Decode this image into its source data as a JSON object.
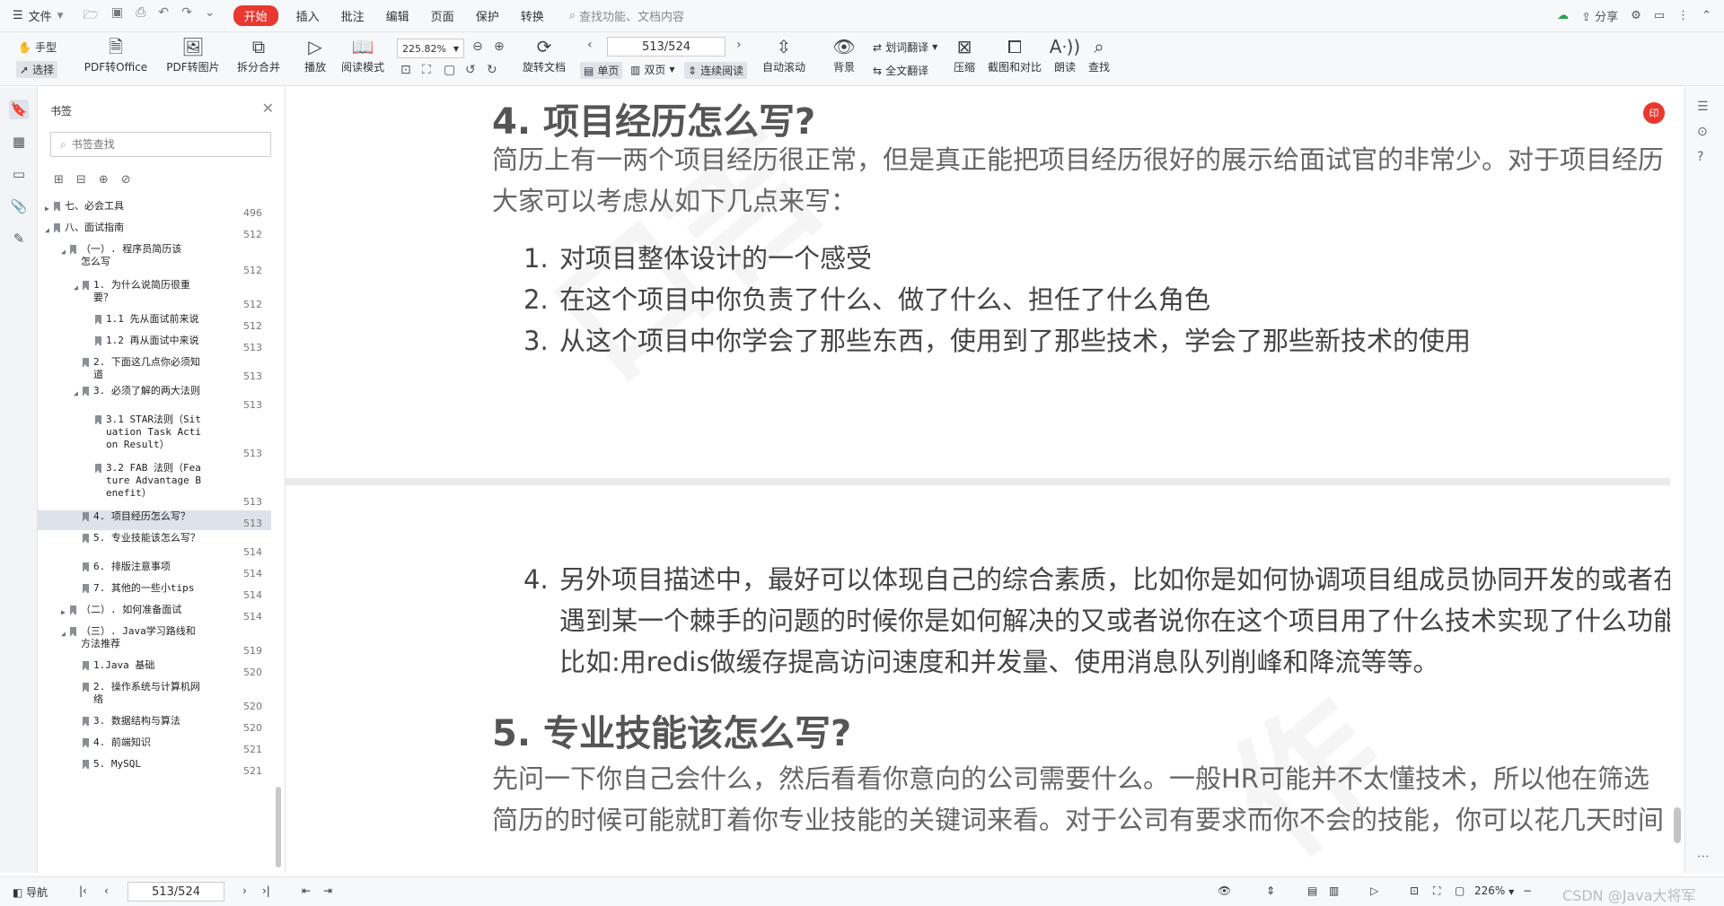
{
  "menubar": {
    "file": "文件",
    "tabs": [
      "开始",
      "插入",
      "批注",
      "编辑",
      "页面",
      "保护",
      "转换"
    ],
    "active_tab": "开始",
    "search_placeholder": "查找功能、文档内容",
    "share": "分享"
  },
  "toolbar": {
    "hand": "手型",
    "select": "选择",
    "pdf_to_office": "PDF转Office",
    "pdf_to_image": "PDF转图片",
    "split_merge": "拆分合并",
    "play": "播放",
    "read_mode": "阅读模式",
    "zoom": "225.82%",
    "rotate": "旋转文档",
    "page_indicator": "513/524",
    "single_page": "单页",
    "double_page": "双页",
    "continuous": "连续阅读",
    "auto_scroll": "自动滚动",
    "background": "背景",
    "word_translate": "划词翻译",
    "full_translate": "全文翻译",
    "compress": "压缩",
    "screenshot_compare": "截图和对比",
    "read_aloud": "朗读",
    "find": "查找"
  },
  "bookmark_panel": {
    "title": "书签",
    "search_placeholder": "书签查找",
    "items": [
      {
        "label": "七、必会工具",
        "page": "496",
        "level": 0,
        "toggle": "collapsed"
      },
      {
        "label": "八、面试指南",
        "page": "512",
        "level": 0,
        "toggle": "expanded"
      },
      {
        "label": "（一）. 程序员简历该怎么写",
        "page": "512",
        "level": 1,
        "toggle": "expanded"
      },
      {
        "label": "1. 为什么说简历很重要？",
        "page": "512",
        "level": 2,
        "toggle": "expanded"
      },
      {
        "label": "1.1 先从面试前来说",
        "page": "512",
        "level": 3,
        "toggle": "none"
      },
      {
        "label": "1.2 再从面试中来说",
        "page": "513",
        "level": 3,
        "toggle": "none"
      },
      {
        "label": "2. 下面这几点你必须知道",
        "page": "513",
        "level": 2,
        "toggle": "none"
      },
      {
        "label": "3. 必须了解的两大法则",
        "page": "513",
        "level": 2,
        "toggle": "expanded"
      },
      {
        "label": "3.1 STAR法则（Situation Task Action Result）",
        "page": "513",
        "level": 3,
        "toggle": "none"
      },
      {
        "label": "3.2 FAB 法则（Feature Advantage Benefit）",
        "page": "513",
        "level": 3,
        "toggle": "none"
      },
      {
        "label": "4. 项目经历怎么写？",
        "page": "513",
        "level": 2,
        "toggle": "none",
        "selected": true
      },
      {
        "label": "5. 专业技能该怎么写？",
        "page": "514",
        "level": 2,
        "toggle": "none"
      },
      {
        "label": "6. 排版注意事项",
        "page": "514",
        "level": 2,
        "toggle": "none"
      },
      {
        "label": "7. 其他的一些小tips",
        "page": "514",
        "level": 2,
        "toggle": "none"
      },
      {
        "label": "（二）. 如何准备面试",
        "page": "514",
        "level": 1,
        "toggle": "collapsed"
      },
      {
        "label": "（三）. Java学习路线和方法推荐",
        "page": "519",
        "level": 1,
        "toggle": "expanded"
      },
      {
        "label": "1.Java 基础",
        "page": "520",
        "level": 2,
        "toggle": "none"
      },
      {
        "label": "2. 操作系统与计算机网络",
        "page": "520",
        "level": 2,
        "toggle": "none"
      },
      {
        "label": "3. 数据结构与算法",
        "page": "520",
        "level": 2,
        "toggle": "none"
      },
      {
        "label": "4. 前端知识",
        "page": "521",
        "level": 2,
        "toggle": "none"
      },
      {
        "label": "5. MySQL",
        "page": "521",
        "level": 2,
        "toggle": "none"
      }
    ]
  },
  "document": {
    "heading4": "4. 项目经历怎么写?",
    "intro_line1": "简历上有一两个项目经历很正常，但是真正能把项目经历很好的展示给面试官的非常少。对于项目经历",
    "intro_line2": "大家可以考虑从如下几点来写：",
    "list": [
      {
        "num": "1.",
        "text": "对项目整体设计的一个感受"
      },
      {
        "num": "2.",
        "text": "在这个项目中你负责了什么、做了什么、担任了什么角色"
      },
      {
        "num": "3.",
        "text": "从这个项目中你学会了那些东西，使用到了那些技术，学会了那些新技术的使用"
      }
    ],
    "item4_num": "4.",
    "item4_line1": "另外项目描述中，最好可以体现自己的综合素质，比如你是如何协调项目组成员协同开发的或者在",
    "item4_line2": "遇到某一个棘手的问题的时候你是如何解决的又或者说你在这个项目用了什么技术实现了什么功能",
    "item4_line3": "比如:用redis做缓存提高访问速度和并发量、使用消息队列削峰和降流等等。",
    "heading5": "5. 专业技能该怎么写?",
    "para5_line1": "先问一下你自己会什么，然后看看你意向的公司需要什么。一般HR可能并不太懂技术，所以他在筛选",
    "para5_line2": "简历的时候可能就盯着你专业技能的关键词来看。对于公司有要求而你不会的技能，你可以花几天时间"
  },
  "fab_label": "印",
  "statusbar": {
    "nav": "导航",
    "page": "513/524",
    "zoom": "226%",
    "watermark_text": "CSDN @Java大将军"
  }
}
